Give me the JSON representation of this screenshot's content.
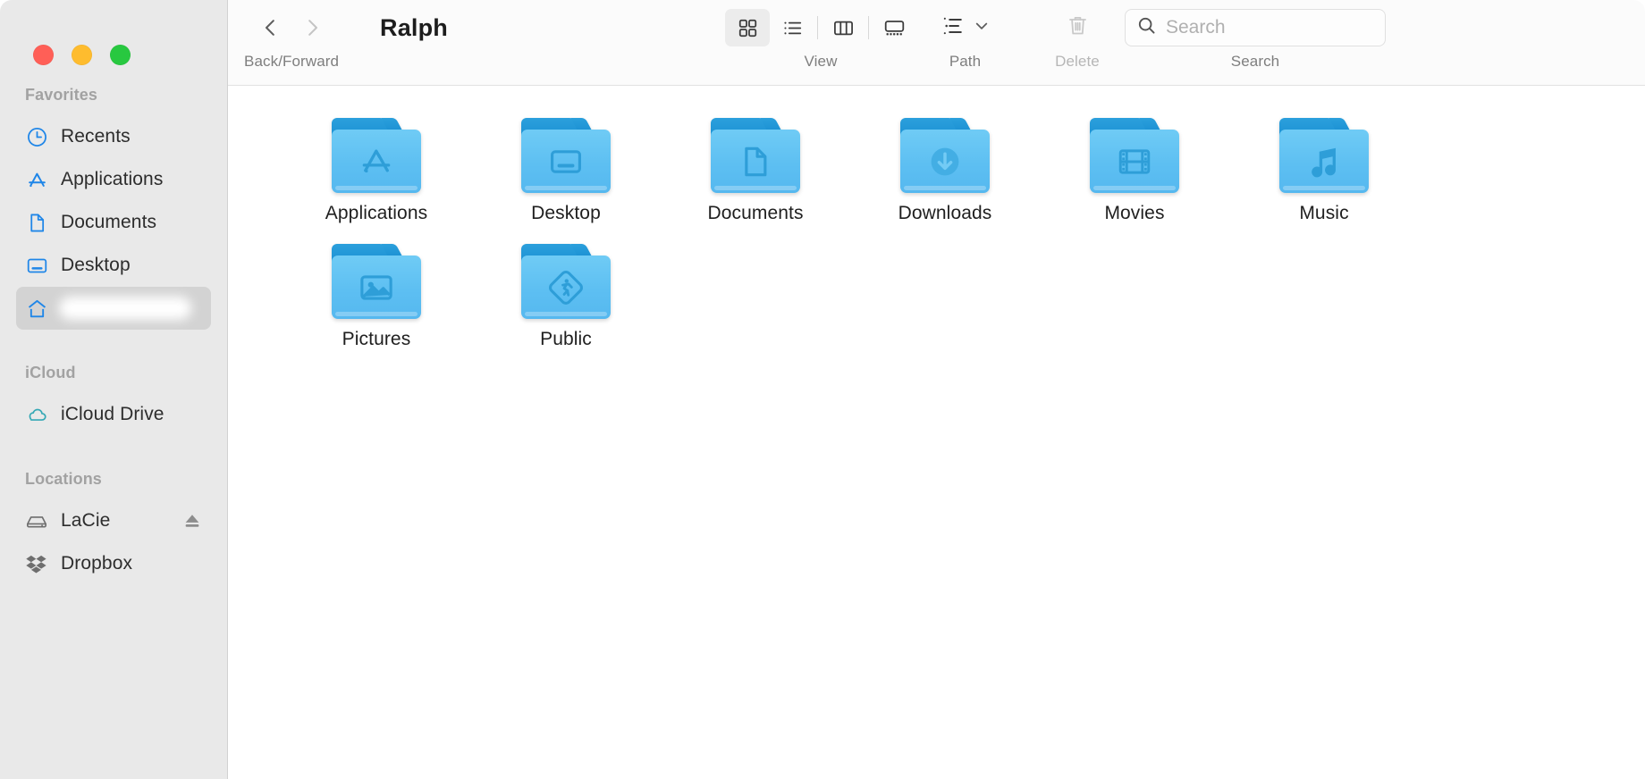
{
  "window": {
    "traffic_lights": [
      {
        "name": "close",
        "color": "#ff5f57"
      },
      {
        "name": "minimize",
        "color": "#febc2e"
      },
      {
        "name": "maximize",
        "color": "#28c840"
      }
    ]
  },
  "sidebar": {
    "sections": [
      {
        "title": "Favorites",
        "items": [
          {
            "label": "Recents",
            "icon": "clock-icon",
            "selected": false
          },
          {
            "label": "Applications",
            "icon": "app-store-icon",
            "selected": false
          },
          {
            "label": "Documents",
            "icon": "document-icon",
            "selected": false
          },
          {
            "label": "Desktop",
            "icon": "desktop-icon",
            "selected": false
          },
          {
            "label": "",
            "icon": "home-icon",
            "selected": true,
            "redacted": true
          }
        ]
      },
      {
        "title": "iCloud",
        "items": [
          {
            "label": "iCloud Drive",
            "icon": "cloud-icon",
            "selected": false
          }
        ]
      },
      {
        "title": "Locations",
        "items": [
          {
            "label": "LaCie",
            "icon": "external-drive-icon",
            "selected": false,
            "eject": true
          },
          {
            "label": "Dropbox",
            "icon": "dropbox-icon",
            "selected": false
          }
        ]
      }
    ]
  },
  "toolbar": {
    "back_forward_caption": "Back/Forward",
    "back_icon": "chevron-left-icon",
    "forward_icon": "chevron-right-icon",
    "title": "Ralph",
    "view_caption": "View",
    "view_buttons": [
      {
        "name": "icon-view",
        "icon": "grid-icon",
        "active": true
      },
      {
        "name": "list-view",
        "icon": "list-icon",
        "active": false
      },
      {
        "name": "column-view",
        "icon": "columns-icon",
        "active": false
      },
      {
        "name": "gallery-view",
        "icon": "gallery-icon",
        "active": false
      }
    ],
    "path_caption": "Path",
    "path_icon": "path-list-icon",
    "path_chevron": "chevron-down-icon",
    "delete_caption": "Delete",
    "delete_icon": "trash-icon",
    "search_caption": "Search",
    "search_icon": "search-icon",
    "search_value": "",
    "search_placeholder": "Search"
  },
  "content": {
    "items": [
      {
        "label": "Applications",
        "glyph": "app-store-glyph"
      },
      {
        "label": "Desktop",
        "glyph": "desktop-glyph"
      },
      {
        "label": "Documents",
        "glyph": "document-glyph"
      },
      {
        "label": "Downloads",
        "glyph": "download-glyph"
      },
      {
        "label": "Movies",
        "glyph": "film-glyph"
      },
      {
        "label": "Music",
        "glyph": "music-note-glyph"
      },
      {
        "label": "Pictures",
        "glyph": "photo-glyph"
      },
      {
        "label": "Public",
        "glyph": "public-dropbox-glyph"
      }
    ]
  },
  "colors": {
    "sidebar_bg": "#e9e9e9",
    "toolbar_bg": "#fbfbfb",
    "accent_blue": "#1d92d4",
    "folder_blue": "#5dbff2",
    "sidebar_icon_blue": "#1f86e8",
    "icloud_teal": "#35a8b5"
  }
}
